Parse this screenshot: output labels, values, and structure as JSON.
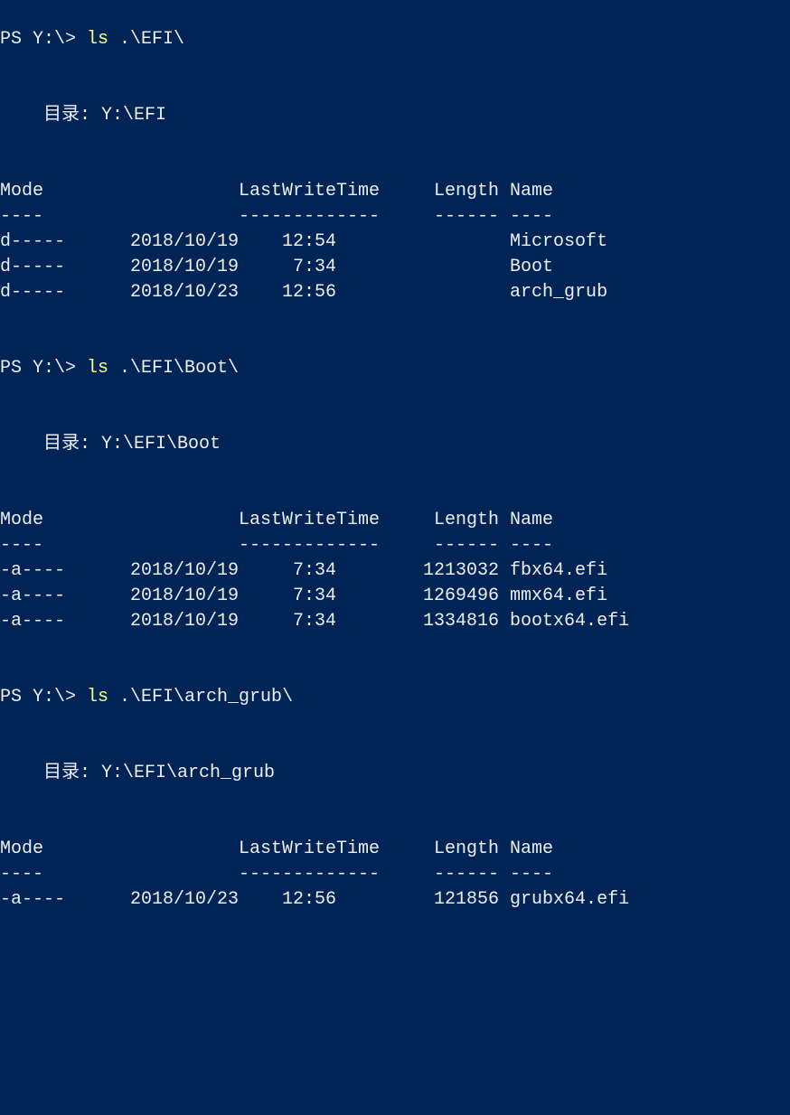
{
  "prompt": "PS Y:\\> ",
  "dir_label_prefix": "    目录: ",
  "headers": {
    "mode": "Mode",
    "lastwrite": "LastWriteTime",
    "length": "Length",
    "name": "Name"
  },
  "rules": {
    "mode": "----",
    "lastwrite": "-------------",
    "length": "------",
    "name": "----"
  },
  "listings": [
    {
      "command": "ls",
      "arg": ".\\EFI\\",
      "directory": "Y:\\EFI",
      "rows": [
        {
          "mode": "d-----",
          "date": "2018/10/19",
          "time": "12:54",
          "length": "",
          "name": "Microsoft"
        },
        {
          "mode": "d-----",
          "date": "2018/10/19",
          "time": "7:34",
          "length": "",
          "name": "Boot"
        },
        {
          "mode": "d-----",
          "date": "2018/10/23",
          "time": "12:56",
          "length": "",
          "name": "arch_grub"
        }
      ]
    },
    {
      "command": "ls",
      "arg": ".\\EFI\\Boot\\",
      "directory": "Y:\\EFI\\Boot",
      "rows": [
        {
          "mode": "-a----",
          "date": "2018/10/19",
          "time": "7:34",
          "length": "1213032",
          "name": "fbx64.efi"
        },
        {
          "mode": "-a----",
          "date": "2018/10/19",
          "time": "7:34",
          "length": "1269496",
          "name": "mmx64.efi"
        },
        {
          "mode": "-a----",
          "date": "2018/10/19",
          "time": "7:34",
          "length": "1334816",
          "name": "bootx64.efi"
        }
      ]
    },
    {
      "command": "ls",
      "arg": ".\\EFI\\arch_grub\\",
      "directory": "Y:\\EFI\\arch_grub",
      "rows": [
        {
          "mode": "-a----",
          "date": "2018/10/23",
          "time": "12:56",
          "length": "121856",
          "name": "grubx64.efi"
        }
      ]
    }
  ]
}
